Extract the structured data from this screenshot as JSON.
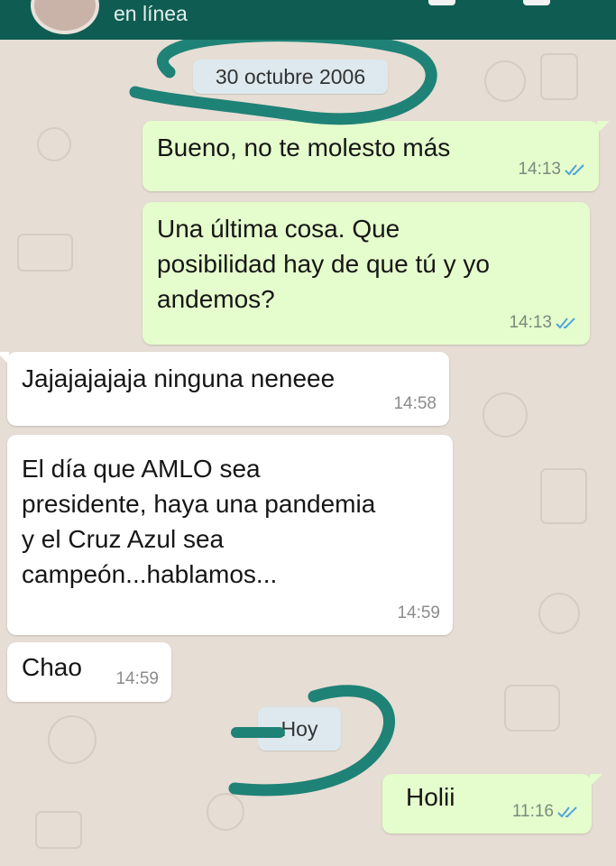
{
  "header": {
    "status": "en línea"
  },
  "date_separators": {
    "first": "30 octubre 2006",
    "second": "Hoy"
  },
  "messages": [
    {
      "text": "Bueno, no te molesto más",
      "time": "14:13"
    },
    {
      "text": "Una última cosa. Que\nposibilidad hay de que tú y yo\nandemos?",
      "time": "14:13"
    },
    {
      "text": "Jajajajajaja ninguna neneee",
      "time": "14:58"
    },
    {
      "text": "El día que AMLO sea\npresidente, haya una pandemia\ny el Cruz Azul sea\ncampeón...hablamos...",
      "time": "14:59"
    },
    {
      "text": "Chao",
      "time": "14:59"
    },
    {
      "text": "Holii",
      "time": "11:16"
    }
  ],
  "colors": {
    "header": "#0f5c52",
    "outgoing_bubble": "#e5fccc",
    "incoming_bubble": "#ffffff",
    "wallpaper": "#e6ddd4",
    "read_ticks": "#4fa5d8",
    "annotation_marker": "#1f8276"
  },
  "icons": [
    "avatar",
    "double-check-icon",
    "menu-icon"
  ]
}
